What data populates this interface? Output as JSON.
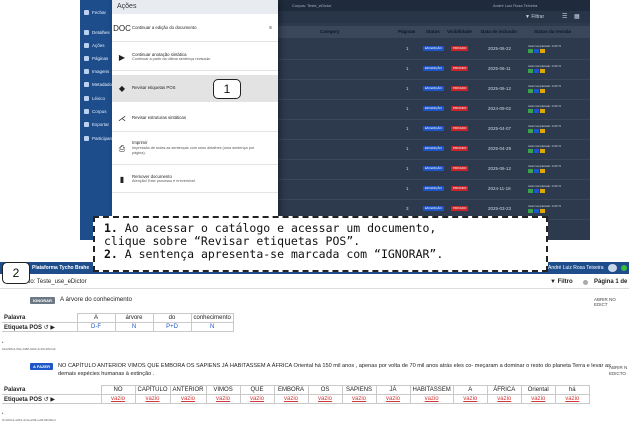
{
  "menu": {
    "title": "Ações",
    "items": [
      {
        "icon": "DOC",
        "title": "Continuar a edição do documento",
        "sub": "",
        "tail": "≡"
      },
      {
        "icon": "▶",
        "title": "Continuar anotação sintática",
        "sub": "Continuar a partir da última sentença revisada.",
        "tail": ""
      },
      {
        "icon": "◆",
        "title": "Revisar etiquetas POS",
        "sub": "",
        "tail": ""
      },
      {
        "icon": "⋌",
        "title": "Revisar estruturas sintáticas",
        "sub": "",
        "tail": ""
      },
      {
        "icon": "⎙",
        "title": "Imprimir",
        "sub": "Impressão de todas as sentenças com seus detalhes (uma sentença por página).",
        "tail": ""
      },
      {
        "icon": "▮",
        "title": "Remover documento",
        "sub": "Atenção! Este processo é irreversível.",
        "tail": ""
      }
    ]
  },
  "sidebar": {
    "items": [
      "Fechar",
      "Detalhes",
      "Ações",
      "Páginas",
      "Imagens",
      "Metadados",
      "Léxico",
      "Corpus",
      "Exportar",
      "Participantes"
    ]
  },
  "background": {
    "corpus_label": "Corpus: Teste_eDictor",
    "user": "André Luiz Rosa Teixeira",
    "filter": "Filtrar",
    "headers": [
      "Category",
      "Páginas",
      "Status",
      "Visibilidade",
      "Data de inclusão",
      "Status da revisão"
    ],
    "rows": [
      {
        "pages": "1",
        "status": "EM EDIÇÃO",
        "vis": "PRIVADO",
        "date": "2025-06-22"
      },
      {
        "pages": "1",
        "status": "EM EDIÇÃO",
        "vis": "PRIVADO",
        "date": "2025-06-11"
      },
      {
        "pages": "1",
        "status": "EM EDIÇÃO",
        "vis": "PRIVADO",
        "date": "2025-06-12"
      },
      {
        "pages": "1",
        "status": "EM EDIÇÃO",
        "vis": "PRIVADO",
        "date": "2024-09-02"
      },
      {
        "pages": "1",
        "status": "EM EDIÇÃO",
        "vis": "PRIVADO",
        "date": "2025-04-07"
      },
      {
        "pages": "1",
        "status": "EM EDIÇÃO",
        "vis": "PRIVADO",
        "date": "2025-04-29"
      },
      {
        "pages": "1",
        "status": "EM EDIÇÃO",
        "vis": "PRIVADO",
        "date": "2025-06-12"
      },
      {
        "pages": "1",
        "status": "EM EDIÇÃO",
        "vis": "PRIVADO",
        "date": "2024-11-18"
      },
      {
        "pages": "3",
        "status": "EM EDIÇÃO",
        "vis": "PRIVADO",
        "date": "2025-03-23"
      }
    ],
    "revision_total": "total",
    "revision_complete": "completado: 0.00 %"
  },
  "callouts": {
    "one": "1",
    "two": "2"
  },
  "note": {
    "n1": "1.",
    "line1": " Ao acessar o catálogo e acessar um documento,",
    "line2": "clique sobre “Revisar etiquetas POS”.",
    "n2": "2.",
    "line3": " A sentença apresenta-se marcada com “IGNORAR”."
  },
  "bottom": {
    "platform": "Plataforma Tycho Brahe",
    "user": "André Luiz Rosa Teixeira",
    "document": "Documento: Teste_use_eDictor",
    "filter": "Filtro",
    "page": "Página 1 de",
    "sentence1": {
      "tag": "IGNORAR",
      "text": "A árvore do conhecimento",
      "right": "ABRIR NO EDICT",
      "row_palavra": "Palavra",
      "row_pos": "Etiqueta POS",
      "words": [
        "A",
        "árvore",
        "do",
        "conhecimento"
      ],
      "tags": [
        "D-F",
        "N",
        "P+D",
        "N"
      ],
      "id": "6a2298e4-ff6a-4d88-9a9b-4c45c2ff2ca9"
    },
    "sentence2": {
      "tag": "A FAZER",
      "text": "NO CAPÍTULO ANTERIOR VIMOS QUE EMBORA OS SAPIENS JÁ HABITASSEM A ÁFRICA Oriental há 150 mil anos , apenas por volta de 70 mil anos atrás eles co- meçaram a dominar o resto do planeta Terra e levar as demais espécies humanas à extinção .",
      "right1": "ABRIR N",
      "right2": "EDICTO",
      "row_palavra": "Palavra",
      "row_pos": "Etiqueta POS",
      "words": [
        "NO",
        "CAPÍTULO",
        "ANTERIOR",
        "VIMOS",
        "QUE",
        "EMBORA",
        "OS",
        "SAPIENS",
        "JÁ",
        "HABITASSEM",
        "A",
        "ÁFRICA",
        "Oriental",
        "há"
      ],
      "empty": "vazio",
      "id": "f1c0d6e3-a093-4c3a-a99f-ed0f13b0bbef"
    }
  }
}
